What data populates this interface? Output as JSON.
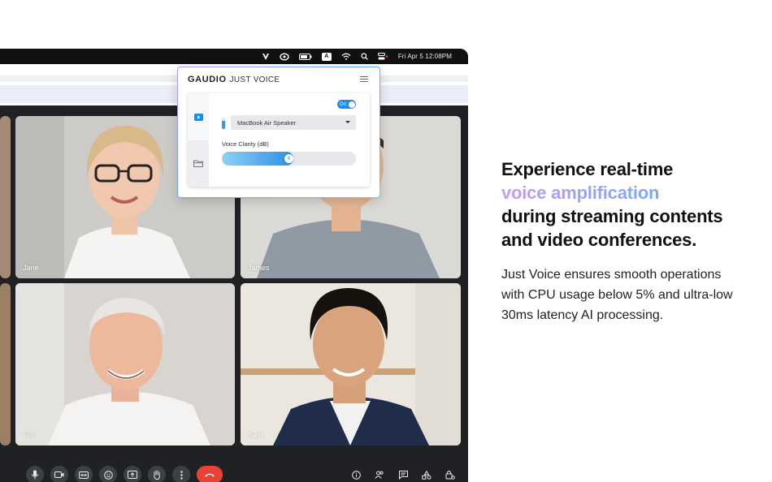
{
  "menubar": {
    "datetime": "Fri Apr 5 12:08PM",
    "keyboard_indicator": "A"
  },
  "participants": [
    {
      "name": "Jane"
    },
    {
      "name": "James"
    },
    {
      "name": "Tim"
    },
    {
      "name": "Sam"
    }
  ],
  "popup": {
    "brand": "GAUDIO",
    "product": "JUST VOICE",
    "toggle_label": "On",
    "toggle_state": "on",
    "output_device": "MacBook Air Speaker",
    "voice_clarity_label": "Voice Clarity (dB)",
    "voice_clarity_value": "6",
    "voice_clarity_fraction": 0.5
  },
  "call_controls": [
    "mic-icon",
    "camera-icon",
    "captions-icon",
    "emoji-icon",
    "present-icon",
    "raise-hand-icon",
    "more-icon",
    "end-call-icon"
  ],
  "side_controls": [
    "info-icon",
    "people-icon",
    "chat-icon",
    "activities-icon",
    "host-controls-icon"
  ],
  "marketing": {
    "headline_line1": "Experience real-time",
    "headline_highlight": "voice amplification",
    "headline_line3": "during streaming contents",
    "headline_line4": "and video conferences.",
    "body_line1": "Just Voice ensures smooth operations",
    "body_line2": "with CPU usage below 5% and ultra-low",
    "body_line3": "30ms latency AI processing."
  },
  "colors": {
    "accent_blue": "#1e8de8",
    "end_call_red": "#ea4335",
    "gradient_start": "#c79bf2",
    "gradient_end": "#50b6f0"
  }
}
